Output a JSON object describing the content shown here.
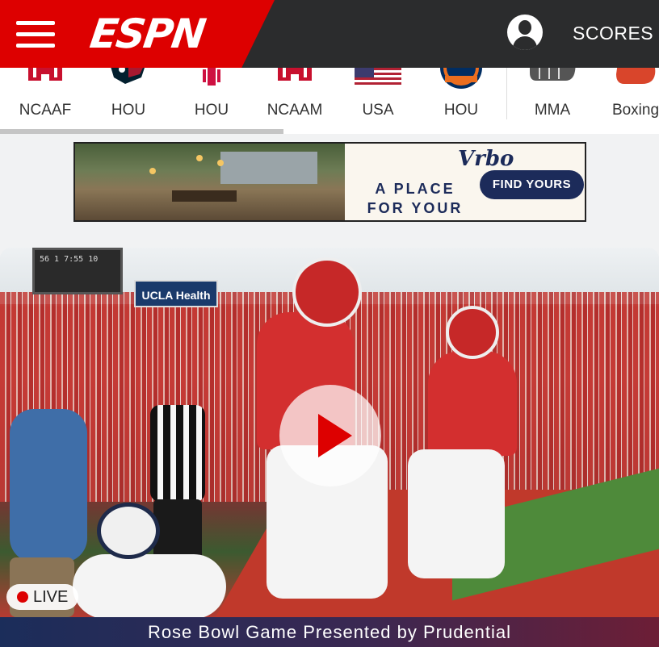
{
  "header": {
    "logo": "ESPN",
    "scores_label": "SCORES",
    "colors": {
      "brand_red": "#dd0000",
      "bar_dark": "#2b2c2d"
    }
  },
  "teams": [
    {
      "label": "NCAAF",
      "icon": "houston-cougars-logo-icon"
    },
    {
      "label": "HOU",
      "icon": "houston-texans-logo-icon"
    },
    {
      "label": "HOU",
      "icon": "houston-rockets-logo-icon"
    },
    {
      "label": "NCAAM",
      "icon": "houston-cougars-logo-icon"
    },
    {
      "label": "USA",
      "icon": "us-flag-icon"
    },
    {
      "label": "HOU",
      "icon": "houston-astros-logo-icon"
    },
    {
      "label": "MMA",
      "icon": "fist-glove-icon"
    },
    {
      "label": "Boxing",
      "icon": "boxing-glove-icon"
    }
  ],
  "ad": {
    "brand": "Vrbo",
    "tagline": "A PLACE FOR YOUR TEAM",
    "cta": "FIND YOURS"
  },
  "hero": {
    "live_label": "LIVE",
    "caption": "Rose Bowl Game Presented by Prudential",
    "scoreboard_text": "56 1 7:55 10",
    "sponsor_sign": "UCLA Health"
  }
}
